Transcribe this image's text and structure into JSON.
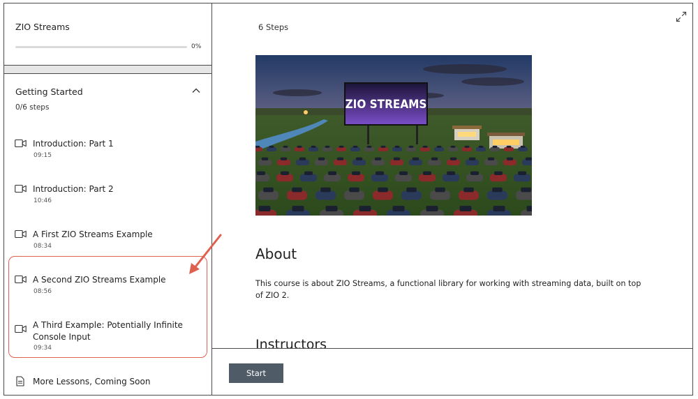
{
  "course": {
    "title": "ZIO Streams",
    "progress_pct": 0,
    "progress_label": "0%"
  },
  "section": {
    "title": "Getting Started",
    "count": "0/6 steps"
  },
  "lessons": [
    {
      "title": "Introduction: Part 1",
      "duration": "09:15",
      "icon": "video-icon"
    },
    {
      "title": "Introduction: Part 2",
      "duration": "10:46",
      "icon": "video-icon"
    },
    {
      "title": "A First ZIO Streams Example",
      "duration": "08:34",
      "icon": "video-icon"
    },
    {
      "title": "A Second ZIO Streams Example",
      "duration": "08:56",
      "icon": "video-icon"
    },
    {
      "title": "A Third Example: Potentially Infinite Console Input",
      "duration": "09:34",
      "icon": "video-icon"
    },
    {
      "title": "More Lessons, Coming Soon",
      "icon": "document-icon"
    }
  ],
  "main": {
    "steps": "6 Steps",
    "hero_sign": "ZIO STREAMS",
    "about_heading": "About",
    "about_text": "This course is about ZIO Streams, a functional library for working with streaming data, built on top of ZIO 2.",
    "instructors_heading": "Instructors",
    "start_label": "Start"
  },
  "colors": {
    "highlight": "#e0604f",
    "button": "#4f5b67"
  }
}
